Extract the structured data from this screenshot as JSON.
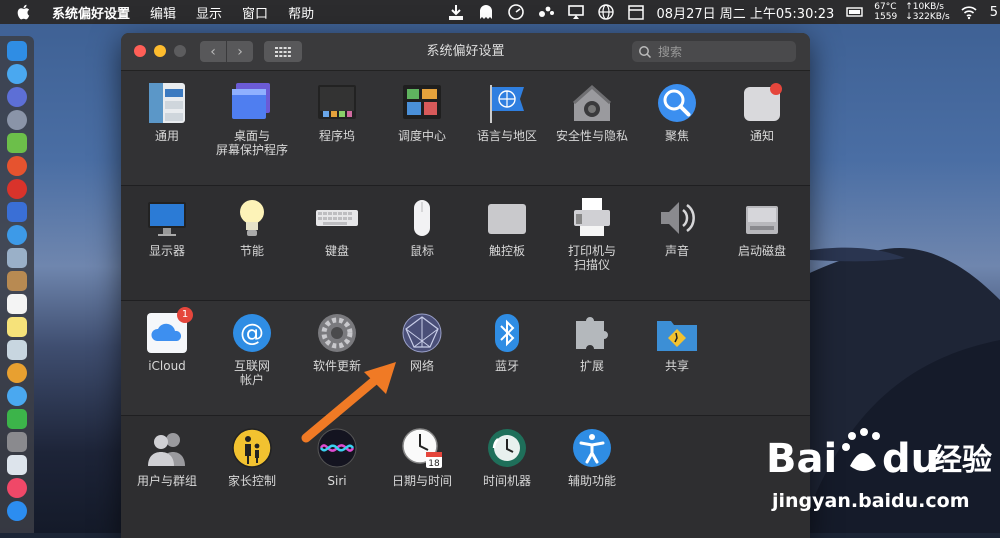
{
  "menubar": {
    "app_name": "系统偏好设置",
    "menus": [
      "编辑",
      "显示",
      "窗口",
      "帮助"
    ],
    "clock": "08月27日 周二 上午05:30:23",
    "temp": "67°C",
    "fan": "1559",
    "net_up": "↑10KB/s",
    "net_down": "↓322KB/s",
    "edge_digit": "5"
  },
  "window": {
    "title": "系统偏好设置",
    "search_placeholder": "搜索"
  },
  "sections": [
    [
      {
        "label": "通用",
        "icon": "general-icon"
      },
      {
        "label": "桌面与\n屏幕保护程序",
        "icon": "desktop-icon"
      },
      {
        "label": "程序坞",
        "icon": "dock-icon"
      },
      {
        "label": "调度中心",
        "icon": "mission-control-icon"
      },
      {
        "label": "语言与地区",
        "icon": "language-icon"
      },
      {
        "label": "安全性与隐私",
        "icon": "security-icon"
      },
      {
        "label": "聚焦",
        "icon": "spotlight-icon"
      },
      {
        "label": "通知",
        "icon": "notifications-icon"
      }
    ],
    [
      {
        "label": "显示器",
        "icon": "displays-icon"
      },
      {
        "label": "节能",
        "icon": "energy-icon"
      },
      {
        "label": "键盘",
        "icon": "keyboard-icon"
      },
      {
        "label": "鼠标",
        "icon": "mouse-icon"
      },
      {
        "label": "触控板",
        "icon": "trackpad-icon"
      },
      {
        "label": "打印机与\n扫描仪",
        "icon": "printer-icon"
      },
      {
        "label": "声音",
        "icon": "sound-icon"
      },
      {
        "label": "启动磁盘",
        "icon": "startup-disk-icon"
      }
    ],
    [
      {
        "label": "iCloud",
        "icon": "icloud-icon",
        "badge": "1"
      },
      {
        "label": "互联网\n帐户",
        "icon": "internet-accounts-icon"
      },
      {
        "label": "软件更新",
        "icon": "software-update-icon"
      },
      {
        "label": "网络",
        "icon": "network-icon"
      },
      {
        "label": "蓝牙",
        "icon": "bluetooth-icon"
      },
      {
        "label": "扩展",
        "icon": "extensions-icon"
      },
      {
        "label": "共享",
        "icon": "sharing-icon"
      }
    ],
    [
      {
        "label": "用户与群组",
        "icon": "users-icon"
      },
      {
        "label": "家长控制",
        "icon": "parental-icon"
      },
      {
        "label": "Siri",
        "icon": "siri-icon"
      },
      {
        "label": "日期与时间",
        "icon": "datetime-icon"
      },
      {
        "label": "时间机器",
        "icon": "timemachine-icon"
      },
      {
        "label": "辅助功能",
        "icon": "accessibility-icon"
      }
    ]
  ],
  "watermark": {
    "brand": "Bai",
    "brand2": "du",
    "brand_cn": "经验",
    "url": "jingyan.baidu.com"
  },
  "colors": {
    "accent_orange": "#f07a25",
    "close": "#ff5f57",
    "minimize": "#febc2e"
  }
}
